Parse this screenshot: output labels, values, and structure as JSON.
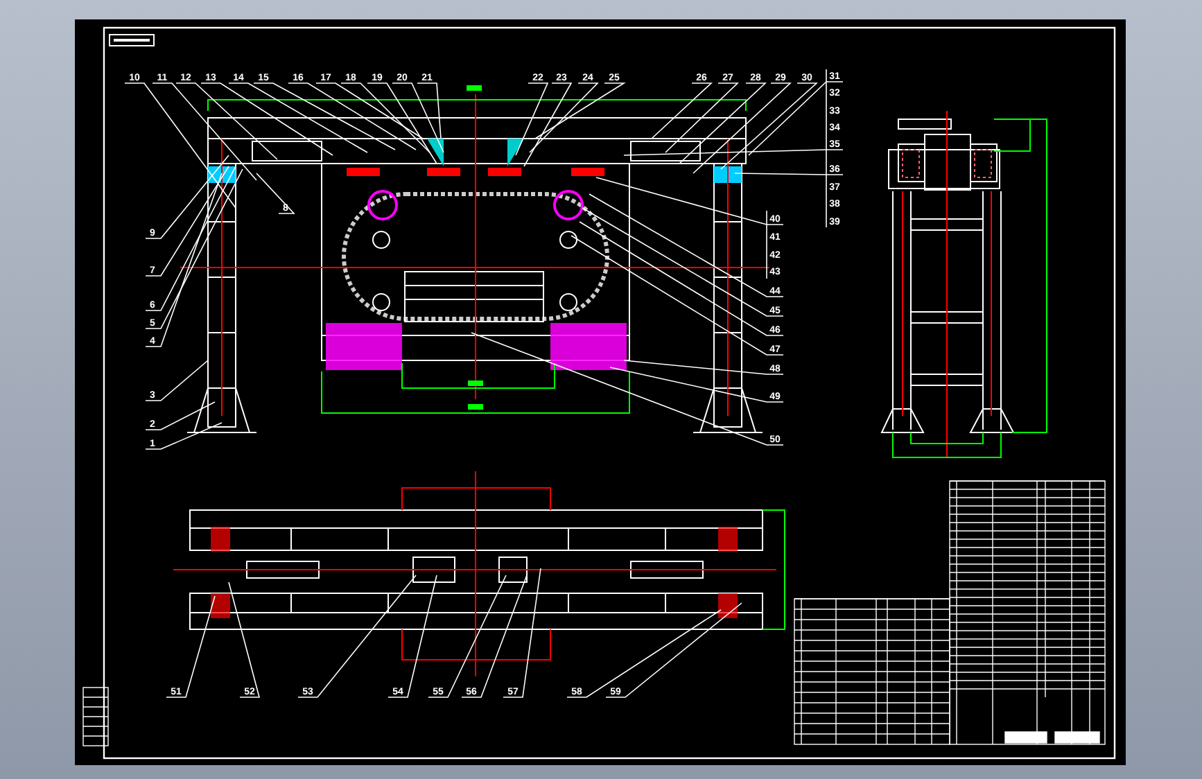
{
  "top_callouts": [
    {
      "label": "10"
    },
    {
      "label": "11"
    },
    {
      "label": "12"
    },
    {
      "label": "13"
    },
    {
      "label": "14"
    },
    {
      "label": "15"
    },
    {
      "label": "16"
    },
    {
      "label": "17"
    },
    {
      "label": "18"
    },
    {
      "label": "19"
    },
    {
      "label": "20"
    },
    {
      "label": "21"
    },
    {
      "label": "22"
    },
    {
      "label": "23"
    },
    {
      "label": "24"
    },
    {
      "label": "25"
    },
    {
      "label": "26"
    },
    {
      "label": "27"
    },
    {
      "label": "28"
    },
    {
      "label": "29"
    },
    {
      "label": "30"
    }
  ],
  "right_callouts": [
    {
      "label": "31"
    },
    {
      "label": "32"
    },
    {
      "label": "33"
    },
    {
      "label": "34"
    },
    {
      "label": "35"
    },
    {
      "label": "36"
    },
    {
      "label": "37"
    },
    {
      "label": "38"
    },
    {
      "label": "39"
    }
  ],
  "side_callouts": [
    {
      "label": "40"
    },
    {
      "label": "41"
    },
    {
      "label": "42"
    },
    {
      "label": "43"
    },
    {
      "label": "44"
    },
    {
      "label": "45"
    },
    {
      "label": "46"
    },
    {
      "label": "47"
    },
    {
      "label": "48"
    },
    {
      "label": "49"
    },
    {
      "label": "50"
    }
  ],
  "left_callouts": [
    {
      "label": "8"
    },
    {
      "label": "9"
    },
    {
      "label": "7"
    },
    {
      "label": "6"
    },
    {
      "label": "5"
    },
    {
      "label": "4"
    },
    {
      "label": "3"
    },
    {
      "label": "2"
    },
    {
      "label": "1"
    }
  ],
  "bottom_callouts": [
    {
      "label": "51"
    },
    {
      "label": "52"
    },
    {
      "label": "53"
    },
    {
      "label": "54"
    },
    {
      "label": "55"
    },
    {
      "label": "56"
    },
    {
      "label": "57"
    },
    {
      "label": "58"
    },
    {
      "label": "59"
    }
  ]
}
